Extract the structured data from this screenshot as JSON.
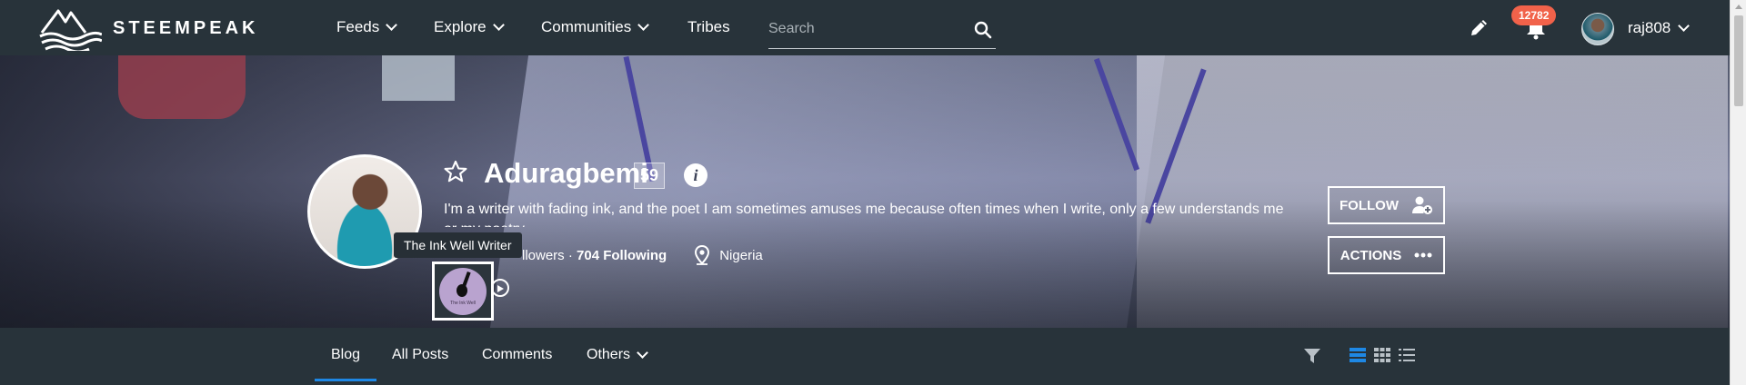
{
  "brand": {
    "name": "STEEMPEAK",
    "logo_icon": "mountain-waves-logo"
  },
  "nav": {
    "items": [
      {
        "label": "Feeds",
        "has_dropdown": true
      },
      {
        "label": "Explore",
        "has_dropdown": true
      },
      {
        "label": "Communities",
        "has_dropdown": true
      },
      {
        "label": "Tribes",
        "has_dropdown": false
      }
    ],
    "search_placeholder": "Search"
  },
  "header_right": {
    "notification_count": "12782",
    "username": "raj808"
  },
  "profile": {
    "name": "Aduragbemi",
    "reputation": "59",
    "bio": "I'm a writer with fading ink, and the poet I am sometimes amuses me because often times when I write, only a few understands me or my poetry.",
    "followers_suffix": "llowers",
    "following": "704 Following",
    "location": "Nigeria",
    "community_tooltip": "The Ink Well Writer",
    "community_logo_text": "The Ink Well"
  },
  "buttons": {
    "follow": "FOLLOW",
    "actions": "ACTIONS"
  },
  "tabs": [
    {
      "label": "Blog",
      "active": true
    },
    {
      "label": "All Posts"
    },
    {
      "label": "Comments"
    },
    {
      "label": "Others",
      "has_dropdown": true
    }
  ],
  "colors": {
    "accent": "#1e88e5",
    "badge": "#f1624a",
    "nav_bg": "#28333a"
  }
}
